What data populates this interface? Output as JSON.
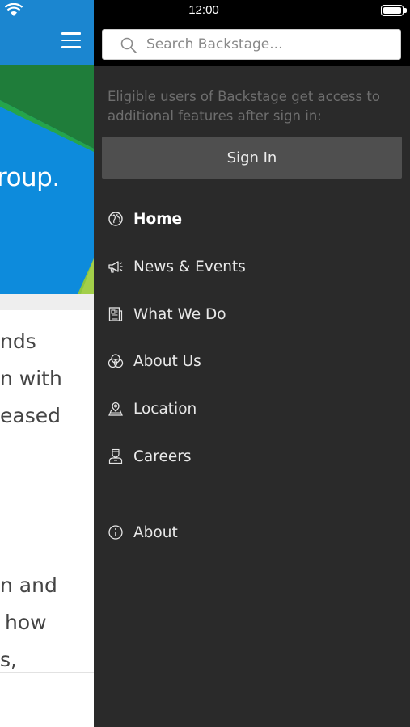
{
  "status_bar": {
    "time": "12:00"
  },
  "background_page": {
    "hero_text": "roup.",
    "body_lines": [
      "nds",
      "n with",
      "eased",
      "n and",
      "how",
      "s,"
    ]
  },
  "drawer": {
    "search": {
      "placeholder": "Search Backstage..."
    },
    "notice": "Eligible users of Backstage get access to additional features after sign in:",
    "sign_in_label": "Sign In",
    "nav_items": [
      {
        "label": "Home",
        "icon": "globe-icon",
        "active": true
      },
      {
        "label": "News & Events",
        "icon": "megaphone-icon"
      },
      {
        "label": "What We Do",
        "icon": "document-icon"
      },
      {
        "label": "About Us",
        "icon": "circles-icon"
      },
      {
        "label": "Location",
        "icon": "map-pin-icon"
      },
      {
        "label": "Careers",
        "icon": "person-icon"
      }
    ],
    "secondary_items": [
      {
        "label": "About",
        "icon": "info-icon"
      }
    ]
  },
  "colors": {
    "drawer_bg": "#2a2a2a",
    "header_blue": "#1b86d0",
    "hero_green": "#1f7d3a",
    "lime": "#8cc63f"
  }
}
